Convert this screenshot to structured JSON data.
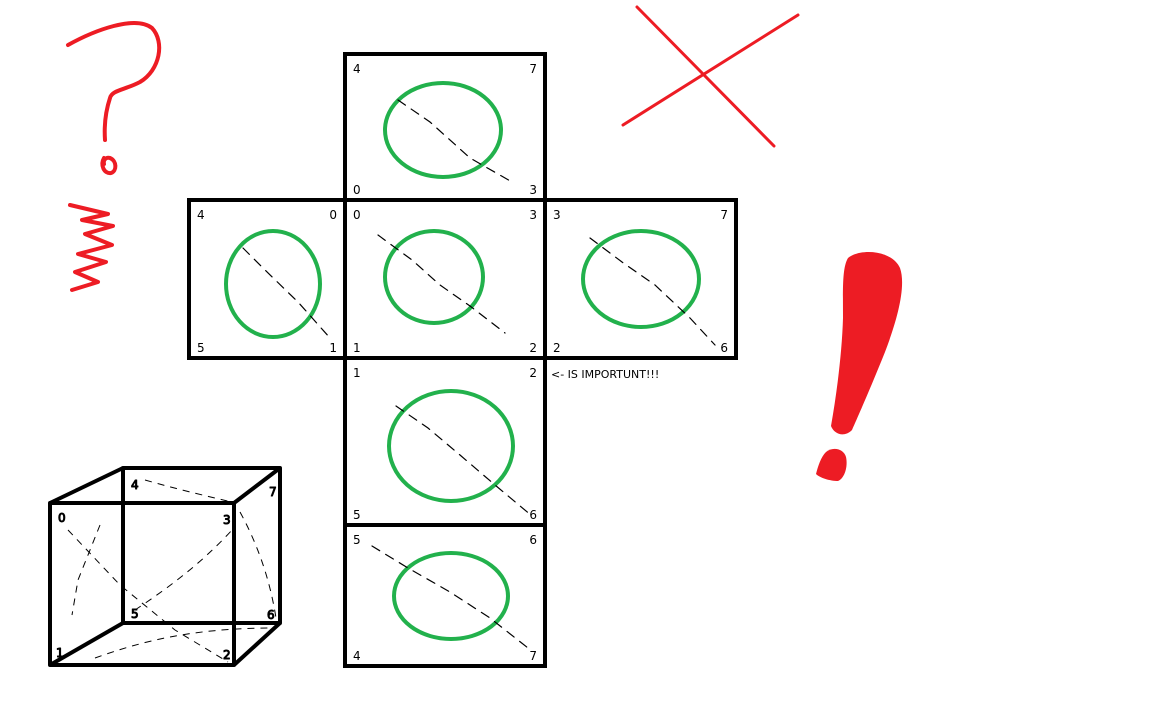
{
  "colors": {
    "outline": "#000000",
    "circle": "#22b14c",
    "scribble": "#ed1c24",
    "background": "#ffffff"
  },
  "annotation": "<- IS IMPORTUNT!!!",
  "faces": [
    {
      "id": "top",
      "labels": {
        "tl": "4",
        "tr": "7",
        "bl": "0",
        "br": "3"
      }
    },
    {
      "id": "left",
      "labels": {
        "tl": "4",
        "tr": "0",
        "bl": "5",
        "br": "1"
      }
    },
    {
      "id": "front",
      "labels": {
        "tl": "0",
        "tr": "3",
        "bl": "1",
        "br": "2"
      }
    },
    {
      "id": "right",
      "labels": {
        "tl": "3",
        "tr": "7",
        "bl": "2",
        "br": "6"
      }
    },
    {
      "id": "bottom",
      "labels": {
        "tl": "1",
        "tr": "2",
        "bl": "5",
        "br": "6"
      }
    },
    {
      "id": "back",
      "labels": {
        "tl": "5",
        "tr": "6",
        "bl": "4",
        "br": "7"
      }
    }
  ],
  "cube_vertices": [
    "0",
    "1",
    "2",
    "3",
    "4",
    "5",
    "6",
    "7"
  ]
}
